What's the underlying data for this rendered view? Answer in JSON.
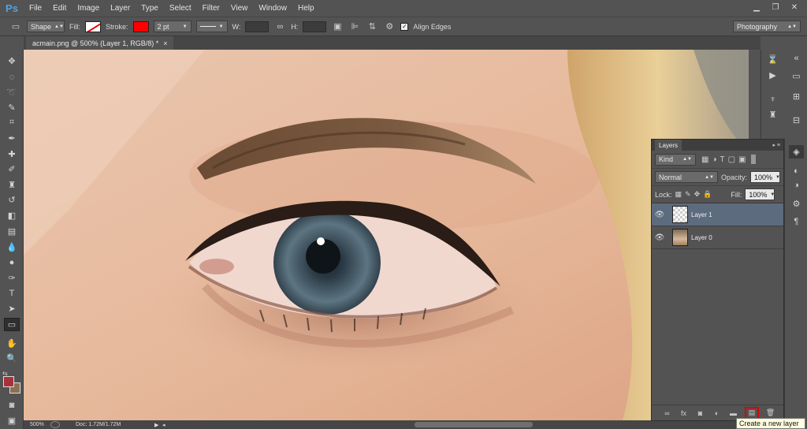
{
  "app": {
    "logo": "Ps"
  },
  "menu": [
    "File",
    "Edit",
    "Image",
    "Layer",
    "Type",
    "Select",
    "Filter",
    "View",
    "Window",
    "Help"
  ],
  "window_controls": {
    "minimize": "▁",
    "restore": "❐",
    "close": "✕"
  },
  "options": {
    "mode_value": "Shape",
    "fill_label": "Fill:",
    "stroke_label": "Stroke:",
    "stroke_size": "2 pt",
    "w_label": "W:",
    "h_label": "H:",
    "align_edges_label": "Align Edges",
    "align_edges_checked": true,
    "workspace_value": "Photography",
    "stroke_color": "#ff0000"
  },
  "document": {
    "tab_title": "acmain.png @ 500% (Layer 1, RGB/8) *",
    "tab_close": "×"
  },
  "status": {
    "zoom": "500%",
    "doc_info": "Doc: 1.72M/1.72M"
  },
  "layers_panel": {
    "title": "Layers",
    "kind_label": "Kind",
    "blend_mode": "Normal",
    "opacity_label": "Opacity:",
    "opacity_value": "100%",
    "lock_label": "Lock:",
    "fill_label": "Fill:",
    "fill_value": "100%",
    "layers": [
      {
        "name": "Layer 1",
        "selected": true
      },
      {
        "name": "Layer 0",
        "selected": false
      }
    ]
  },
  "tooltip": {
    "text": "Create a new layer"
  },
  "colors": {
    "foreground": "#a8323c",
    "background": "#8a7055",
    "accent": "#d00000"
  }
}
